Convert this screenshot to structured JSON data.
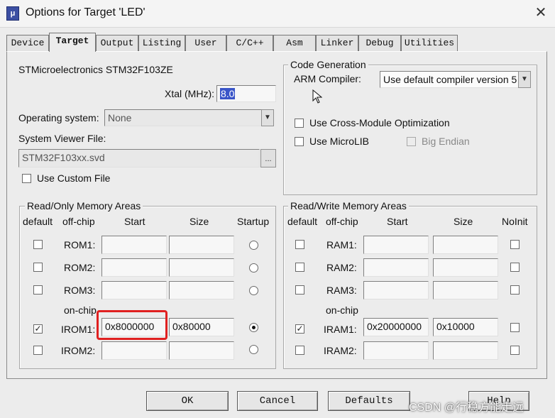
{
  "window": {
    "title": "Options for Target 'LED'",
    "icon_glyph": "μ",
    "close_glyph": "✕"
  },
  "tabs": [
    {
      "label": "Device",
      "active": false
    },
    {
      "label": "Target",
      "active": true
    },
    {
      "label": "Output",
      "active": false
    },
    {
      "label": "Listing",
      "active": false
    },
    {
      "label": "User",
      "active": false
    },
    {
      "label": "C/C++",
      "active": false
    },
    {
      "label": "Asm",
      "active": false
    },
    {
      "label": "Linker",
      "active": false
    },
    {
      "label": "Debug",
      "active": false
    },
    {
      "label": "Utilities",
      "active": false
    }
  ],
  "device": {
    "name": "STMicroelectronics STM32F103ZE",
    "xtal_label": "Xtal (MHz):",
    "xtal_value": "8.0",
    "os_label": "Operating system:",
    "os_value": "None",
    "svf_label": "System Viewer File:",
    "svf_value": "STM32F103xx.svd",
    "browse_label": "...",
    "custom_file_label": "Use Custom File"
  },
  "codegen": {
    "title": "Code Generation",
    "compiler_label": "ARM Compiler:",
    "compiler_value": "Use default compiler version 5",
    "cross_module_label": "Use Cross-Module Optimization",
    "microlib_label": "Use MicroLIB",
    "big_endian_label": "Big Endian"
  },
  "rom": {
    "title": "Read/Only Memory Areas",
    "headers": {
      "default": "default",
      "offchip": "off-chip",
      "start": "Start",
      "size": "Size",
      "startup": "Startup"
    },
    "onchip_label": "on-chip",
    "rows": [
      {
        "label": "ROM1:",
        "start": "",
        "size": "",
        "default": false,
        "startup": false
      },
      {
        "label": "ROM2:",
        "start": "",
        "size": "",
        "default": false,
        "startup": false
      },
      {
        "label": "ROM3:",
        "start": "",
        "size": "",
        "default": false,
        "startup": false
      },
      {
        "label": "IROM1:",
        "start": "0x8000000",
        "size": "0x80000",
        "default": true,
        "startup": true
      },
      {
        "label": "IROM2:",
        "start": "",
        "size": "",
        "default": false,
        "startup": false
      }
    ]
  },
  "ram": {
    "title": "Read/Write Memory Areas",
    "headers": {
      "default": "default",
      "offchip": "off-chip",
      "start": "Start",
      "size": "Size",
      "noinit": "NoInit"
    },
    "onchip_label": "on-chip",
    "rows": [
      {
        "label": "RAM1:",
        "start": "",
        "size": "",
        "default": false,
        "noinit": false
      },
      {
        "label": "RAM2:",
        "start": "",
        "size": "",
        "default": false,
        "noinit": false
      },
      {
        "label": "RAM3:",
        "start": "",
        "size": "",
        "default": false,
        "noinit": false
      },
      {
        "label": "IRAM1:",
        "start": "0x20000000",
        "size": "0x10000",
        "default": true,
        "noinit": false
      },
      {
        "label": "IRAM2:",
        "start": "",
        "size": "",
        "default": false,
        "noinit": false
      }
    ]
  },
  "buttons": {
    "ok": "OK",
    "cancel": "Cancel",
    "defaults": "Defaults",
    "help": "Help"
  },
  "watermark": "CSDN @行稳方能走远",
  "colors": {
    "highlight": "#e02020",
    "selection": "#3a55c8"
  }
}
